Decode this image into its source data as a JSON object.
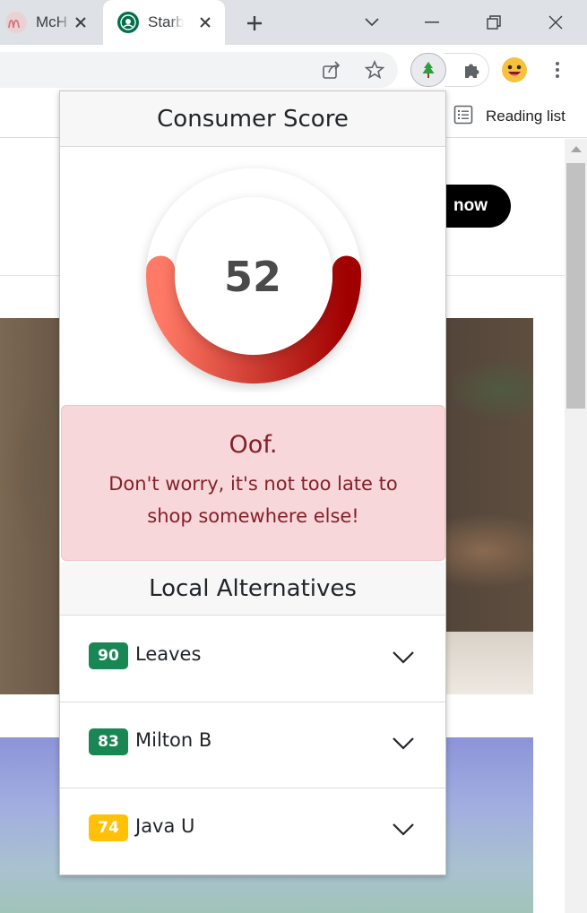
{
  "browser": {
    "tabs": [
      {
        "title": "McH",
        "favicon": "mcdonalds-icon",
        "active": false
      },
      {
        "title": "Starb",
        "favicon": "starbucks-icon",
        "active": true
      }
    ],
    "bookmarks": {
      "reading_list_label": "Reading list"
    }
  },
  "page": {
    "order_button_label": "now"
  },
  "popup": {
    "title": "Consumer Score",
    "score": 52,
    "score_fraction": 0.52,
    "gauge_colors": {
      "start": "#ff7a66",
      "end": "#a00000"
    },
    "alert": {
      "heading": "Oof.",
      "message": "Don't worry, it's not too late to shop somewhere else!"
    },
    "alternatives_title": "Local Alternatives",
    "alternatives": [
      {
        "score": "90",
        "name": "Leaves",
        "badge_color": "#198754",
        "badge_text_color": "#ffffff"
      },
      {
        "score": "83",
        "name": "Milton B",
        "badge_color": "#198754",
        "badge_text_color": "#ffffff"
      },
      {
        "score": "74",
        "name": "Java U",
        "badge_color": "#ffc107",
        "badge_text_color": "#ffffff"
      }
    ]
  }
}
